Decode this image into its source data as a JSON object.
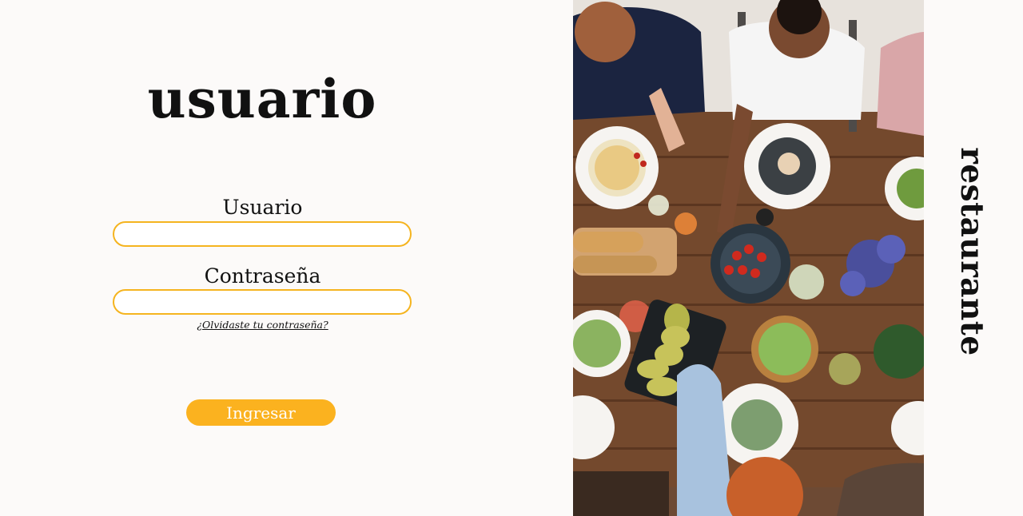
{
  "login": {
    "title": "usuario",
    "user_label": "Usuario",
    "user_value": "",
    "password_label": "Contraseña",
    "password_value": "",
    "forgot_link": "¿Olvidaste tu contraseña?",
    "submit_label": "Ingresar"
  },
  "brand": {
    "name": "restaurante"
  },
  "colors": {
    "accent": "#fbb21f",
    "field_border": "#f5b41f",
    "background": "#fcfaf9",
    "text": "#111111"
  },
  "photo": {
    "subject": "people-sharing-food-at-wooden-table"
  }
}
